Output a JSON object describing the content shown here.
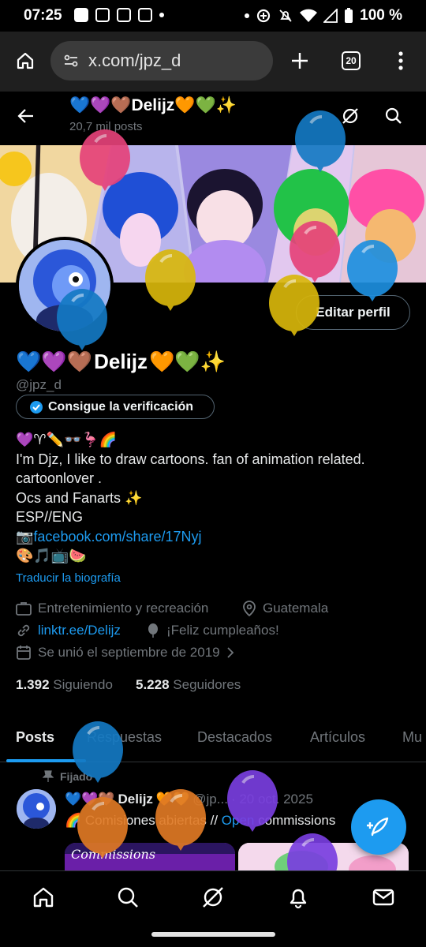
{
  "status_bar": {
    "time": "07:25",
    "battery": "100 %",
    "left_icons": [
      "facebook-icon",
      "instagram-icon",
      "instagram-icon",
      "instagram-icon",
      "dot-icon"
    ],
    "right_icons": [
      "dot-icon",
      "data-saver-icon",
      "mute-icon",
      "wifi-icon",
      "signal-icon",
      "battery-icon"
    ]
  },
  "browser": {
    "url": "x.com/jpz_d",
    "tab_count": "20"
  },
  "profile_header": {
    "name": "Delijz",
    "post_count": "20,7 mil posts"
  },
  "profile": {
    "display_name": "Delijz",
    "handle": "@jpz_d",
    "edit_button": "Editar perfil",
    "verify_button": "Consigue la verificación",
    "bio_lines": [
      "💜♈✏️👓🦩🌈",
      "I'm Djz, I like to draw cartoons. fan of animation related.",
      "cartoonlover .",
      "Ocs and Fanarts ✨",
      "ESP//ENG"
    ],
    "bio_link": "facebook.com/share/17Nyj",
    "bio_last_line": "🎨🎵📺🍉",
    "translate_bio": "Traducir la biografía",
    "category": "Entretenimiento y recreación",
    "location": "Guatemala",
    "website": "linktr.ee/Delijz",
    "birthday": "¡Feliz cumpleaños!",
    "joined": "Se unió el septiembre de 2019",
    "following_count": "1.392",
    "following_label": "Siguiendo",
    "followers_count": "5.228",
    "followers_label": "Seguidores"
  },
  "tabs": [
    "Posts",
    "Respuestas",
    "Destacados",
    "Artículos",
    "Mu"
  ],
  "pinned_post": {
    "pinned_label": "Fijado",
    "author": "Delijz",
    "handle": "@jp...",
    "date": "· 20 oct. 2025",
    "text_prefix": "🌈 Comisiones abiertas // ",
    "text_link": "Open",
    "text_suffix": " commissions",
    "image_caption": "Commissions"
  },
  "bottom_nav": [
    "home-icon",
    "search-icon",
    "grok-icon",
    "notifications-icon",
    "messages-icon"
  ],
  "colors": {
    "accent": "#1d9bf0",
    "background": "#000000",
    "muted_text": "#71767b"
  }
}
